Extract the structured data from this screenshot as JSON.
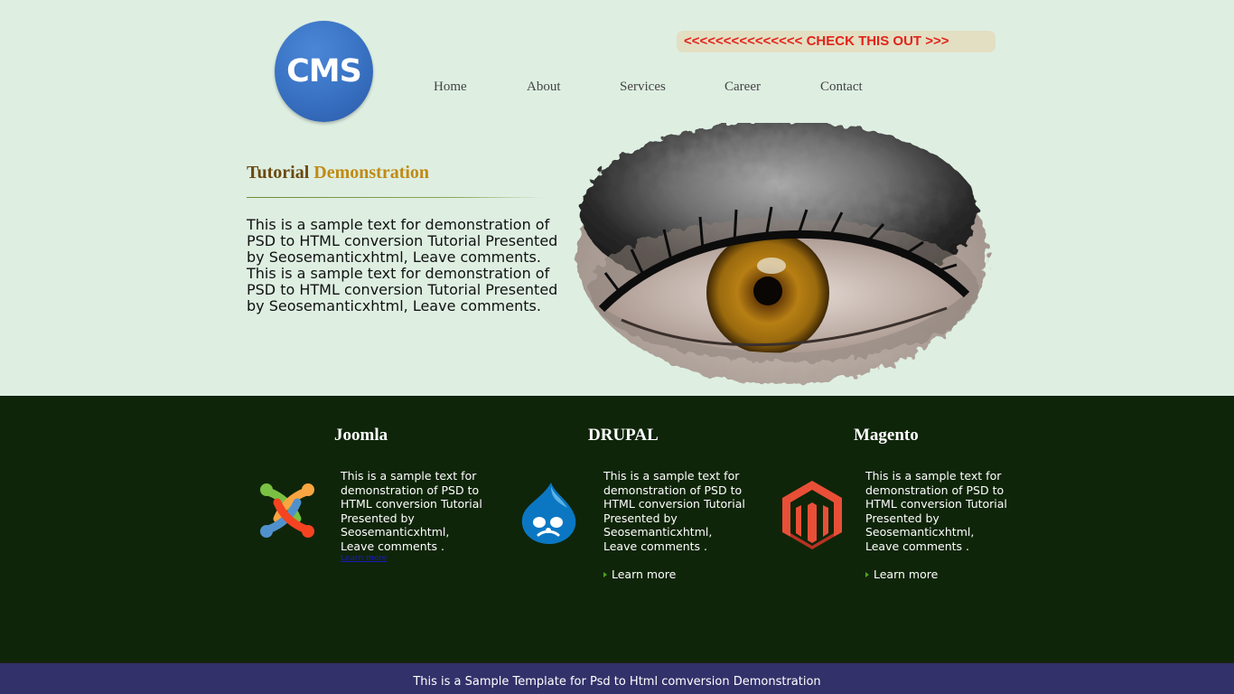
{
  "header": {
    "logo_text": "CMS",
    "promo_text": "<<<<<<<<<<<<<<< CHECK THIS OUT >>>",
    "nav": [
      "Home",
      "About",
      "Services",
      "Career",
      "Contact"
    ]
  },
  "hero": {
    "title_part1": "Tutorial",
    "title_part2": "Demonstration",
    "body": "This is a sample text for demonstration of PSD to HTML conversion Tutorial Presented by Seosemanticxhtml, Leave comments. This is a sample text for demonstration of PSD to HTML conversion Tutorial Presented by Seosemanticxhtml, Leave comments."
  },
  "features": [
    {
      "title": "Joomla",
      "icon": "joomla-logo-icon",
      "text": "This is a sample text for demonstration of PSD to HTML conversion Tutorial Presented by Seosemanticxhtml, Leave comments .",
      "link": "Learn more"
    },
    {
      "title": "DRUPAL",
      "icon": "drupal-logo-icon",
      "text": "This is a sample text for demonstration of PSD to HTML conversion Tutorial Presented by Seosemanticxhtml, Leave comments .",
      "link": "Learn more"
    },
    {
      "title": "Magento",
      "icon": "magento-logo-icon",
      "text": "This is a sample text for demonstration of PSD to HTML conversion Tutorial Presented by Seosemanticxhtml, Leave comments .",
      "link": "Learn more"
    }
  ],
  "footer": {
    "text": "This is a Sample Template for Psd to Html comversion Demonstration"
  },
  "colors": {
    "page_bg": "#deefe2",
    "features_bg": "#0f2509",
    "footer_bg": "#32316a",
    "promo_text": "#e2231a",
    "title_dark": "#6b4a0d",
    "title_gold": "#c18a14"
  }
}
